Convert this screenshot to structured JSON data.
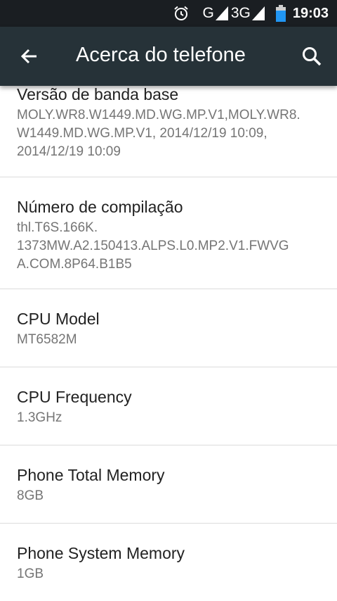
{
  "status_bar": {
    "alarm_icon": "alarm-clock-icon",
    "network_1": "G",
    "network_2": "3G",
    "battery_color": "#2196f3",
    "time": "19:03"
  },
  "app_bar": {
    "title": "Acerca do telefone",
    "back_icon": "arrow-back-icon",
    "search_icon": "search-icon",
    "background": "#263238"
  },
  "settings": [
    {
      "title": "Versão de banda base",
      "summary": "MOLY.WR8.W1449.MD.WG.MP.V1,MOLY.WR8.\nW1449.MD.WG.MP.V1, 2014/12/19 10:09,\n2014/12/19 10:09"
    },
    {
      "title": "Número de compilação",
      "summary": "thl.T6S.166K.\n1373MW.A2.150413.ALPS.L0.MP2.V1.FWVG\nA.COM.8P64.B1B5"
    },
    {
      "title": "CPU Model",
      "summary": "MT6582M"
    },
    {
      "title": "CPU Frequency",
      "summary": "1.3GHz"
    },
    {
      "title": "Phone Total Memory",
      "summary": "8GB"
    },
    {
      "title": "Phone System Memory",
      "summary": "1GB"
    }
  ]
}
